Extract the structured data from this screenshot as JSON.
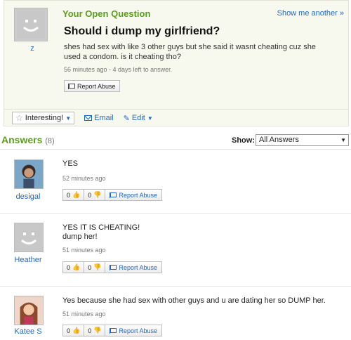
{
  "question": {
    "heading": "Your Open Question",
    "show_more": "Show me another »",
    "asker_name": "z",
    "title": "Should i dump my girlfriend?",
    "body": "shes had sex with like 3 other guys but she said it wasnt cheating cuz she used a condom. is it cheating tho?",
    "meta": "56 minutes ago - 4 days left to answer.",
    "report_label": "Report Abuse"
  },
  "toolbar": {
    "interesting_label": "Interesting!",
    "email_label": "Email",
    "edit_label": "Edit"
  },
  "answers_header": {
    "title": "Answers",
    "count": "(8)",
    "show_label": "Show:",
    "show_value": "All Answers"
  },
  "answers": [
    {
      "name": "desigal",
      "text": "YES",
      "time": "52 minutes ago",
      "up": "0",
      "down": "0",
      "report": "Report Abuse"
    },
    {
      "name": "Heather",
      "text": "YES IT IS CHEATING!\ndump her!",
      "time": "51 minutes ago",
      "up": "0",
      "down": "0",
      "report": "Report Abuse"
    },
    {
      "name": "Katee S",
      "text": "Yes because she had sex with other guys and u are dating her so DUMP her.",
      "time": "51 minutes ago",
      "up": "0",
      "down": "0",
      "report": "Report Abuse"
    }
  ],
  "colors": {
    "accent_green": "#5c9e1e",
    "link_blue": "#1f68c7"
  }
}
